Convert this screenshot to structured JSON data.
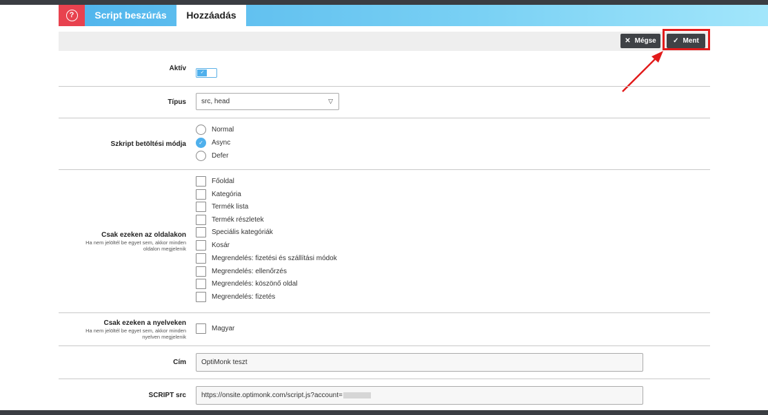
{
  "tabs": {
    "help_icon": "?",
    "script": "Script beszúrás",
    "add": "Hozzáadás"
  },
  "toolbar": {
    "cancel_label": "Mégse",
    "cancel_icon": "close-icon",
    "save_label": "Ment",
    "save_icon": "check-icon"
  },
  "form": {
    "active": {
      "label": "Aktív",
      "value": true
    },
    "type": {
      "label": "Típus",
      "value": "src, head"
    },
    "load_mode": {
      "label": "Szkript betöltési módja",
      "options": [
        "Normal",
        "Async",
        "Defer"
      ],
      "selected": "Async"
    },
    "pages": {
      "label": "Csak ezeken az oldalakon",
      "hint": "Ha nem jelöltél be egyet sem, akkor minden oldalon megjelenik",
      "options": [
        "Főoldal",
        "Kategória",
        "Termék lista",
        "Termék részletek",
        "Speciális kategóriák",
        "Kosár",
        "Megrendelés: fizetési és szállítási módok",
        "Megrendelés: ellenőrzés",
        "Megrendelés: köszönő oldal",
        "Megrendelés: fizetés"
      ]
    },
    "languages": {
      "label": "Csak ezeken a nyelveken",
      "hint": "Ha nem jelöltél be egyet sem, akkor minden nyelven megjelenik",
      "options": [
        "Magyar"
      ]
    },
    "title": {
      "label": "Cím",
      "value": "OptiMonk teszt"
    },
    "script_src": {
      "label": "SCRIPT src",
      "value": "https://onsite.optimonk.com/script.js?account="
    }
  },
  "colors": {
    "accent": "#4fb0ec",
    "help_tab": "#e8424f",
    "button": "#3f4246",
    "highlight": "#e21b1b"
  }
}
